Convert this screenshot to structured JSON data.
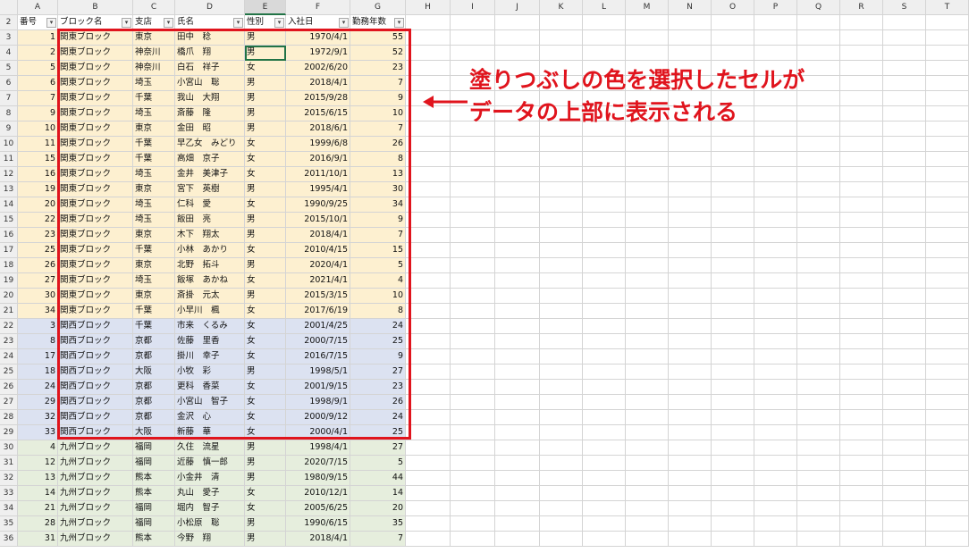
{
  "columns": [
    "A",
    "B",
    "C",
    "D",
    "E",
    "F",
    "G",
    "H",
    "I",
    "J",
    "K",
    "L",
    "M",
    "N",
    "O",
    "P",
    "Q",
    "R",
    "S",
    "T"
  ],
  "table_headers": [
    "番号",
    "ブロック名",
    "支店",
    "氏名",
    "性別",
    "入社日",
    "勤務年数"
  ],
  "rows": [
    {
      "r": "3",
      "no": "1",
      "block": "関東ブロック",
      "branch": "東京",
      "name": "田中　稔",
      "sex": "男",
      "date": "1970/4/1",
      "years": "55",
      "g": "kanto"
    },
    {
      "r": "4",
      "no": "2",
      "block": "関東ブロック",
      "branch": "神奈川",
      "name": "橋爪　翔",
      "sex": "男",
      "date": "1972/9/1",
      "years": "52",
      "g": "kanto"
    },
    {
      "r": "5",
      "no": "5",
      "block": "関東ブロック",
      "branch": "神奈川",
      "name": "白石　祥子",
      "sex": "女",
      "date": "2002/6/20",
      "years": "23",
      "g": "kanto"
    },
    {
      "r": "6",
      "no": "6",
      "block": "関東ブロック",
      "branch": "埼玉",
      "name": "小宮山　聡",
      "sex": "男",
      "date": "2018/4/1",
      "years": "7",
      "g": "kanto"
    },
    {
      "r": "7",
      "no": "7",
      "block": "関東ブロック",
      "branch": "千葉",
      "name": "我山　大翔",
      "sex": "男",
      "date": "2015/9/28",
      "years": "9",
      "g": "kanto"
    },
    {
      "r": "8",
      "no": "9",
      "block": "関東ブロック",
      "branch": "埼玉",
      "name": "斎藤　隆",
      "sex": "男",
      "date": "2015/6/15",
      "years": "10",
      "g": "kanto"
    },
    {
      "r": "9",
      "no": "10",
      "block": "関東ブロック",
      "branch": "東京",
      "name": "金田　昭",
      "sex": "男",
      "date": "2018/6/1",
      "years": "7",
      "g": "kanto"
    },
    {
      "r": "10",
      "no": "11",
      "block": "関東ブロック",
      "branch": "千葉",
      "name": "早乙女　みどり",
      "sex": "女",
      "date": "1999/6/8",
      "years": "26",
      "g": "kanto"
    },
    {
      "r": "11",
      "no": "15",
      "block": "関東ブロック",
      "branch": "千葉",
      "name": "高畑　京子",
      "sex": "女",
      "date": "2016/9/1",
      "years": "8",
      "g": "kanto"
    },
    {
      "r": "12",
      "no": "16",
      "block": "関東ブロック",
      "branch": "埼玉",
      "name": "金井　美津子",
      "sex": "女",
      "date": "2011/10/1",
      "years": "13",
      "g": "kanto"
    },
    {
      "r": "13",
      "no": "19",
      "block": "関東ブロック",
      "branch": "東京",
      "name": "宮下　英樹",
      "sex": "男",
      "date": "1995/4/1",
      "years": "30",
      "g": "kanto"
    },
    {
      "r": "14",
      "no": "20",
      "block": "関東ブロック",
      "branch": "埼玉",
      "name": "仁科　愛",
      "sex": "女",
      "date": "1990/9/25",
      "years": "34",
      "g": "kanto"
    },
    {
      "r": "15",
      "no": "22",
      "block": "関東ブロック",
      "branch": "埼玉",
      "name": "飯田　亮",
      "sex": "男",
      "date": "2015/10/1",
      "years": "9",
      "g": "kanto"
    },
    {
      "r": "16",
      "no": "23",
      "block": "関東ブロック",
      "branch": "東京",
      "name": "木下　翔太",
      "sex": "男",
      "date": "2018/4/1",
      "years": "7",
      "g": "kanto"
    },
    {
      "r": "17",
      "no": "25",
      "block": "関東ブロック",
      "branch": "千葉",
      "name": "小林　あかり",
      "sex": "女",
      "date": "2010/4/15",
      "years": "15",
      "g": "kanto"
    },
    {
      "r": "18",
      "no": "26",
      "block": "関東ブロック",
      "branch": "東京",
      "name": "北野　拓斗",
      "sex": "男",
      "date": "2020/4/1",
      "years": "5",
      "g": "kanto"
    },
    {
      "r": "19",
      "no": "27",
      "block": "関東ブロック",
      "branch": "埼玉",
      "name": "飯塚　あかね",
      "sex": "女",
      "date": "2021/4/1",
      "years": "4",
      "g": "kanto"
    },
    {
      "r": "20",
      "no": "30",
      "block": "関東ブロック",
      "branch": "東京",
      "name": "斎掛　元太",
      "sex": "男",
      "date": "2015/3/15",
      "years": "10",
      "g": "kanto"
    },
    {
      "r": "21",
      "no": "34",
      "block": "関東ブロック",
      "branch": "千葉",
      "name": "小早川　楓",
      "sex": "女",
      "date": "2017/6/19",
      "years": "8",
      "g": "kanto"
    },
    {
      "r": "22",
      "no": "3",
      "block": "関西ブロック",
      "branch": "千葉",
      "name": "市来　くるみ",
      "sex": "女",
      "date": "2001/4/25",
      "years": "24",
      "g": "kansai"
    },
    {
      "r": "23",
      "no": "8",
      "block": "関西ブロック",
      "branch": "京都",
      "name": "佐藤　里香",
      "sex": "女",
      "date": "2000/7/15",
      "years": "25",
      "g": "kansai"
    },
    {
      "r": "24",
      "no": "17",
      "block": "関西ブロック",
      "branch": "京都",
      "name": "掛川　幸子",
      "sex": "女",
      "date": "2016/7/15",
      "years": "9",
      "g": "kansai"
    },
    {
      "r": "25",
      "no": "18",
      "block": "関西ブロック",
      "branch": "大阪",
      "name": "小牧　彩",
      "sex": "男",
      "date": "1998/5/1",
      "years": "27",
      "g": "kansai"
    },
    {
      "r": "26",
      "no": "24",
      "block": "関西ブロック",
      "branch": "京都",
      "name": "更科　香菜",
      "sex": "女",
      "date": "2001/9/15",
      "years": "23",
      "g": "kansai"
    },
    {
      "r": "27",
      "no": "29",
      "block": "関西ブロック",
      "branch": "京都",
      "name": "小宮山　智子",
      "sex": "女",
      "date": "1998/9/1",
      "years": "26",
      "g": "kansai"
    },
    {
      "r": "28",
      "no": "32",
      "block": "関西ブロック",
      "branch": "京都",
      "name": "金沢　心",
      "sex": "女",
      "date": "2000/9/12",
      "years": "24",
      "g": "kansai"
    },
    {
      "r": "29",
      "no": "33",
      "block": "関西ブロック",
      "branch": "大阪",
      "name": "新藤　華",
      "sex": "女",
      "date": "2000/4/1",
      "years": "25",
      "g": "kansai"
    },
    {
      "r": "30",
      "no": "4",
      "block": "九州ブロック",
      "branch": "福岡",
      "name": "久住　流星",
      "sex": "男",
      "date": "1998/4/1",
      "years": "27",
      "g": "kyushu"
    },
    {
      "r": "31",
      "no": "12",
      "block": "九州ブロック",
      "branch": "福岡",
      "name": "近藤　慎一郎",
      "sex": "男",
      "date": "2020/7/15",
      "years": "5",
      "g": "kyushu"
    },
    {
      "r": "32",
      "no": "13",
      "block": "九州ブロック",
      "branch": "熊本",
      "name": "小金井　清",
      "sex": "男",
      "date": "1980/9/15",
      "years": "44",
      "g": "kyushu"
    },
    {
      "r": "33",
      "no": "14",
      "block": "九州ブロック",
      "branch": "熊本",
      "name": "丸山　愛子",
      "sex": "女",
      "date": "2010/12/1",
      "years": "14",
      "g": "kyushu"
    },
    {
      "r": "34",
      "no": "21",
      "block": "九州ブロック",
      "branch": "福岡",
      "name": "堀内　智子",
      "sex": "女",
      "date": "2005/6/25",
      "years": "20",
      "g": "kyushu"
    },
    {
      "r": "35",
      "no": "28",
      "block": "九州ブロック",
      "branch": "福岡",
      "name": "小松原　聡",
      "sex": "男",
      "date": "1990/6/15",
      "years": "35",
      "g": "kyushu"
    },
    {
      "r": "36",
      "no": "31",
      "block": "九州ブロック",
      "branch": "熊本",
      "name": "今野　翔",
      "sex": "男",
      "date": "2018/4/1",
      "years": "7",
      "g": "kyushu"
    }
  ],
  "header_row_number": "2",
  "filter_icon": "dropdown-arrow-icon",
  "annotation": {
    "line1": "塗りつぶしの色を選択したセルが",
    "line2": "データの上部に表示される",
    "color": "#e0141d"
  },
  "colors": {
    "kanto_fill": "#fdf0d0",
    "kansai_fill": "#dce2f1",
    "kyushu_fill": "#e6eedd",
    "highlight_border": "#e0141d"
  }
}
